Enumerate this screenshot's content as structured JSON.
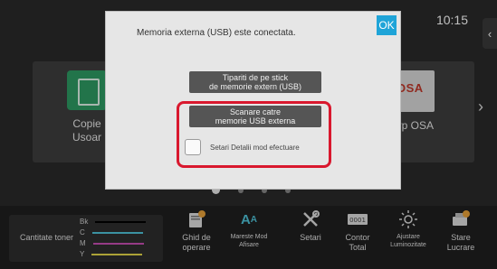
{
  "status": {
    "clock": "10:15"
  },
  "tiles": [
    {
      "label_line1": "Copie",
      "label_line2": "Usoar"
    },
    {
      "label_line1": "arp OSA",
      "logo": "OSA"
    }
  ],
  "pager": {
    "count": 4,
    "active": 1
  },
  "dialog": {
    "message": "Memoria externa (USB) este conectata.",
    "ok_label": "OK",
    "print_usb_line1": "Tipariti de pe stick",
    "print_usb_line2": "de memorie extern (USB)",
    "scan_usb_line1": "Scanare catre",
    "scan_usb_line2": "memorie USB externa",
    "detail_label": "Setari Detalii mod efectuare",
    "highlight_color": "#d9182e"
  },
  "toner": {
    "label": "Cantitate toner",
    "rows": [
      {
        "name": "Bk",
        "color": "#000000"
      },
      {
        "name": "C",
        "color": "#4fc3d8"
      },
      {
        "name": "M",
        "color": "#c94fb3"
      },
      {
        "name": "Y",
        "color": "#e6d84a"
      }
    ]
  },
  "bottom": {
    "guide_line1": "Ghid de",
    "guide_line2": "operare",
    "enlarge_line1": "Mareste Mod",
    "enlarge_line2": "Afisare",
    "settings": "Setari",
    "counter_line1": "Contor",
    "counter_line2": "Total",
    "brightness_line1": "Ajustare",
    "brightness_line2": "Luminozitate",
    "job_line1": "Stare",
    "job_line2": "Lucrare"
  }
}
